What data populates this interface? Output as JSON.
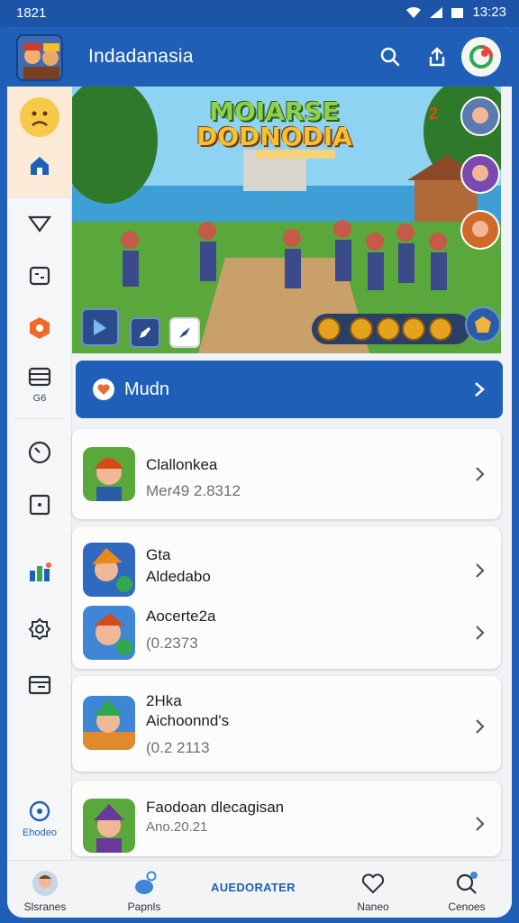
{
  "status_bar": {
    "time": "1821",
    "time_right": "13:23"
  },
  "header": {
    "title": "Indadanasia"
  },
  "banner": {
    "title_line1": "MOIARSE",
    "title_line2": "DODNODIA",
    "badge_count": "2"
  },
  "section": {
    "label": "Mudn"
  },
  "side_rail": {
    "label_lists": "G6",
    "label_bottom": "Ehodeo"
  },
  "games": [
    {
      "name": "Clallonkea",
      "meta": "Mer49 2.8312"
    },
    {
      "name": "Gta",
      "meta": "Aldedabo"
    },
    {
      "name": "Aocerte2a",
      "meta": "(0.2373"
    },
    {
      "name": "2Hka",
      "meta": "Aichoonnd's",
      "meta2": "(0.2 2113"
    },
    {
      "name": "Faodoan dlecagisan",
      "meta": "Ano.20.21"
    }
  ],
  "bottom_nav": {
    "item1": "Slsranes",
    "item2": "Papnls",
    "center": "AUEDORATER",
    "item4": "Naneo",
    "item5": "Cenoes"
  },
  "colors": {
    "brand_blue": "#1f5fb8",
    "background": "#f1f2f4",
    "accent_orange": "#ef6b2c"
  }
}
